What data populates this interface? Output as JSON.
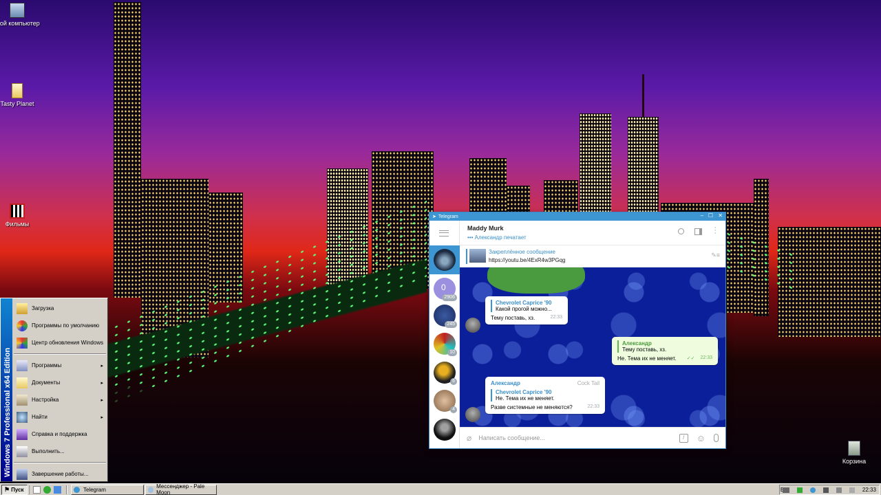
{
  "desktop": {
    "icons": [
      {
        "label": "Мой компьютер"
      },
      {
        "label": "Tasty Planet"
      },
      {
        "label": "Фильмы"
      },
      {
        "label": "Корзина"
      }
    ]
  },
  "start_menu": {
    "banner": "Windows 7 Professional x64 Edition",
    "items": [
      {
        "label": "Загрузка"
      },
      {
        "label": "Программы по умолчанию"
      },
      {
        "label": "Центр обновления Windows"
      },
      {
        "label": "Программы",
        "arrow": "▸"
      },
      {
        "label": "Документы",
        "arrow": "▸"
      },
      {
        "label": "Настройка",
        "arrow": "▸"
      },
      {
        "label": "Найти",
        "arrow": "▸"
      },
      {
        "label": "Справка и поддержка"
      },
      {
        "label": "Выполнить..."
      },
      {
        "label": "Завершение работы..."
      }
    ]
  },
  "taskbar": {
    "start_label": "Пуск",
    "tasks": [
      {
        "label": "Telegram"
      },
      {
        "label": "Мессенджер - Pale Moon"
      }
    ],
    "tray": {
      "lang": "EN",
      "clock": "22:33"
    }
  },
  "telegram": {
    "window_title": "Telegram",
    "chat_name": "Maddy Murk",
    "chat_status": "••• Александр печатает",
    "pinned_title": "Закреплённое сообщение",
    "pinned_text": "https://youtu.be/4ExR4w3PGqg",
    "badges": [
      "2906",
      "245",
      "10",
      "6",
      "4"
    ],
    "messages": [
      {
        "quote_name": "Chevrolet Caprice '90",
        "quote_text": "Какой прогой можно...",
        "text": "Тему поставь, хз.",
        "time": "22:33"
      },
      {
        "quote_name": "Александр",
        "quote_text": "Тему поставь, хз.",
        "text": "Не. Тема их не меняет.",
        "time": "22:33"
      },
      {
        "author": "Александр",
        "tag": "Cock Tail",
        "quote_name": "Chevrolet Caprice '90",
        "quote_text": "Не. Тема их не меняет.",
        "text": "Разве системные не меняются?",
        "time": "22:33"
      }
    ],
    "input_placeholder": "Написать сообщение..."
  }
}
